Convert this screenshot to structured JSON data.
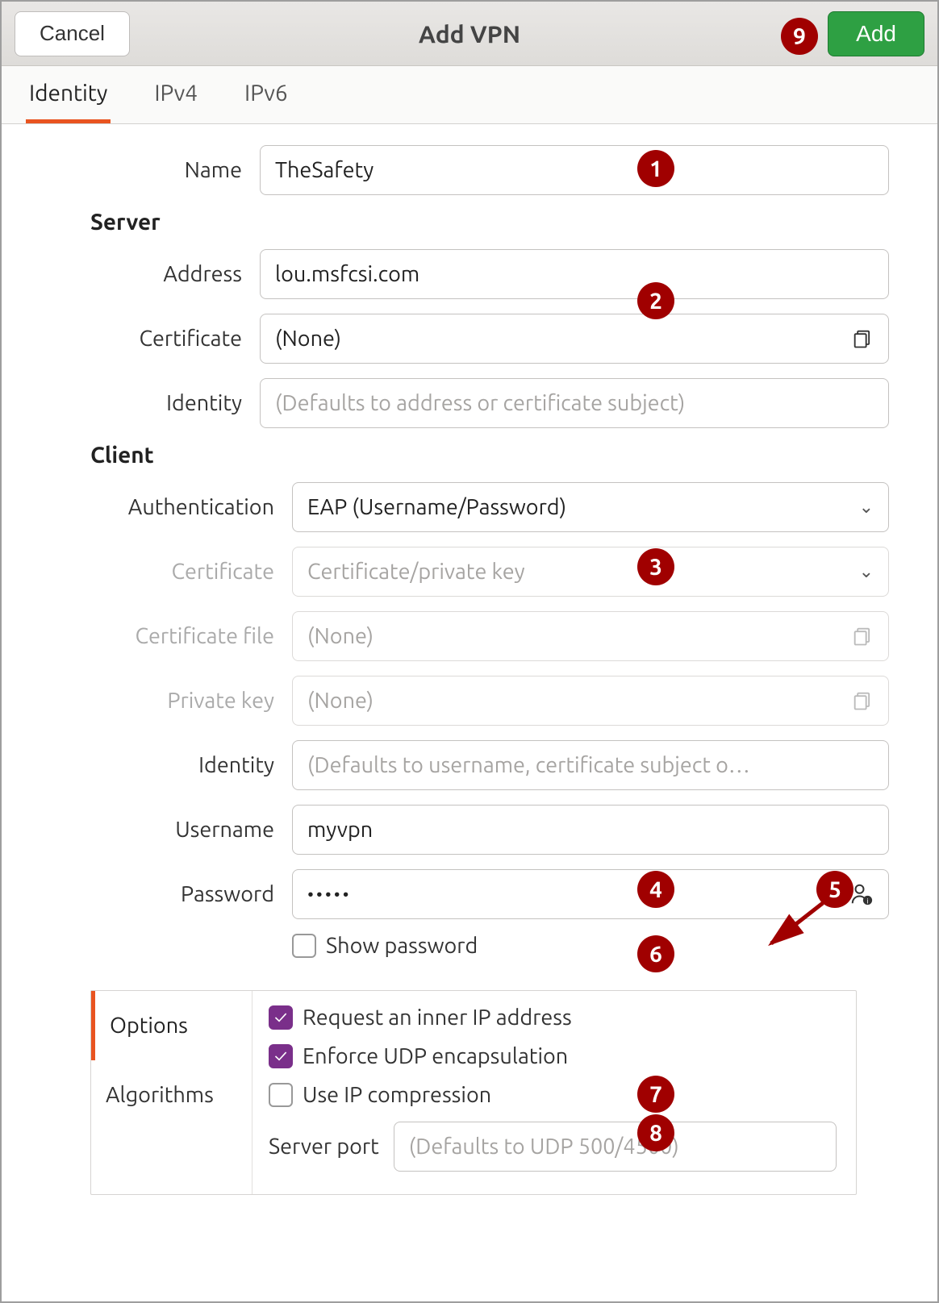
{
  "titlebar": {
    "title": "Add VPN",
    "cancel": "Cancel",
    "add": "Add"
  },
  "tabs": {
    "identity": "Identity",
    "ipv4": "IPv4",
    "ipv6": "IPv6"
  },
  "labels": {
    "name": "Name",
    "server": "Server",
    "address": "Address",
    "certificate": "Certificate",
    "identity": "Identity",
    "client": "Client",
    "authentication": "Authentication",
    "client_certificate": "Certificate",
    "certificate_file": "Certificate file",
    "private_key": "Private key",
    "client_identity": "Identity",
    "username": "Username",
    "password": "Password",
    "show_password": "Show password",
    "options": "Options",
    "algorithms": "Algorithms",
    "request_inner": "Request an inner IP address",
    "enforce_udp": "Enforce UDP encapsulation",
    "ip_compression": "Use IP compression",
    "server_port": "Server port"
  },
  "values": {
    "name": "TheSafety",
    "address": "lou.msfcsi.com",
    "server_certificate": "(None)",
    "server_identity_placeholder": "(Defaults to address or certificate subject)",
    "authentication": "EAP (Username/Password)",
    "client_cert_kind": "Certificate/private key",
    "client_cert_file": "(None)",
    "client_private_key": "(None)",
    "client_identity_placeholder": "(Defaults to username, certificate subject o…",
    "username": "myvpn",
    "password_masked": "•••••",
    "server_port_placeholder": "(Defaults to UDP 500/4500)"
  },
  "checkboxes": {
    "show_password": false,
    "request_inner": true,
    "enforce_udp": true,
    "ip_compression": false
  },
  "annotations": {
    "b1": "1",
    "b2": "2",
    "b3": "3",
    "b4": "4",
    "b5": "5",
    "b6": "6",
    "b7": "7",
    "b8": "8",
    "b9": "9"
  }
}
